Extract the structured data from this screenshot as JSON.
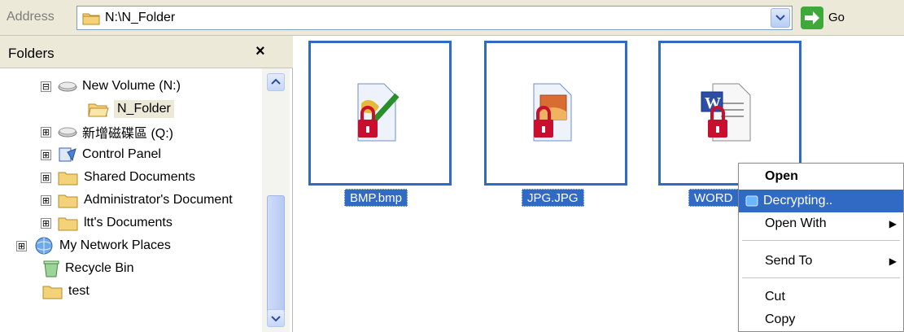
{
  "address_bar": {
    "label": "Address",
    "path": "N:\\N_Folder",
    "go_label": "Go"
  },
  "folders_pane": {
    "title": "Folders",
    "close_symbol": "×",
    "tree": [
      {
        "label": "New Volume (N:)",
        "icon": "drive-icon",
        "expander": "⊟"
      },
      {
        "label": "N_Folder",
        "icon": "folder-open-icon",
        "selected": true
      },
      {
        "label": "新增磁碟區 (Q:)",
        "icon": "drive-icon",
        "expander": "⊞"
      },
      {
        "label": "Control Panel",
        "icon": "control-panel-icon",
        "expander": "⊞"
      },
      {
        "label": "Shared Documents",
        "icon": "folder-icon",
        "expander": "⊞"
      },
      {
        "label": "Administrator's Document",
        "icon": "folder-icon",
        "expander": "⊞"
      },
      {
        "label": "ltt's Documents",
        "icon": "folder-icon",
        "expander": "⊞"
      },
      {
        "label": "My Network Places",
        "icon": "network-icon",
        "expander": "⊞"
      },
      {
        "label": "Recycle Bin",
        "icon": "recycle-bin-icon"
      },
      {
        "label": "test",
        "icon": "folder-icon"
      }
    ]
  },
  "files": [
    {
      "name": "BMP.bmp",
      "icon": "bmp-locked-icon"
    },
    {
      "name": "JPG.JPG",
      "icon": "jpg-locked-icon"
    },
    {
      "name": "WORD",
      "icon": "word-locked-icon"
    }
  ],
  "context_menu": {
    "items": [
      {
        "label": "Open",
        "bold": true
      },
      {
        "label": "Decrypting..",
        "highlighted": true,
        "icon": "decrypt-icon"
      },
      {
        "label": "Open With",
        "submenu": true
      },
      {
        "label": "Send To",
        "submenu": true
      },
      {
        "label": "Cut"
      },
      {
        "label": "Copy"
      }
    ]
  },
  "colors": {
    "selection": "#316ac5",
    "chrome": "#ece9d8",
    "lock": "#c8102e"
  }
}
